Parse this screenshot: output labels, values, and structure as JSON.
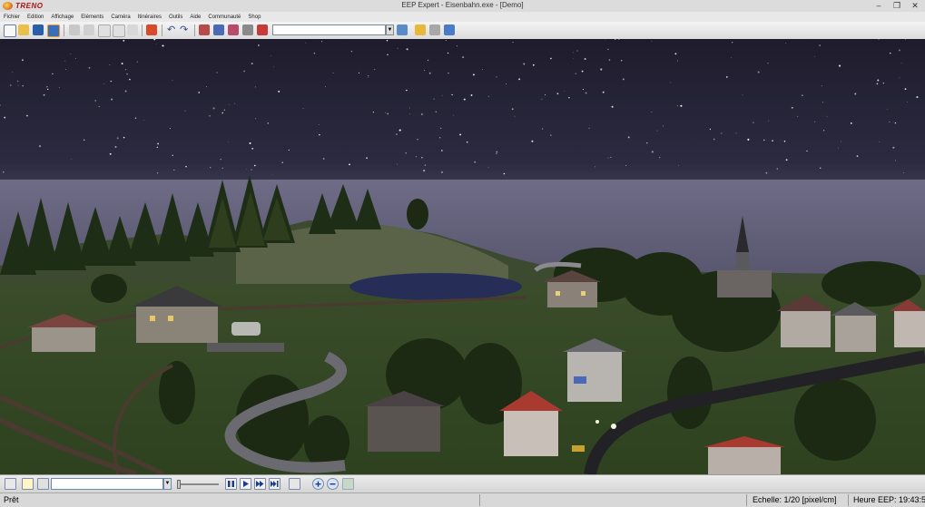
{
  "app": {
    "brand": "TRENO",
    "title": "EEP Expert - Eisenbahn.exe - [Demo]"
  },
  "menu": [
    "Fichier",
    "Edition",
    "Affichage",
    "Eléments",
    "Caméra",
    "Itinéraires",
    "Outils",
    "Aide",
    "Communauté",
    "Shop"
  ],
  "toolbar": {
    "layer_selector_value": "",
    "icons": [
      "new-file-icon",
      "open-folder-icon",
      "save-icon",
      "save-as-icon",
      "print-icon",
      "print-preview-icon",
      "window-icon",
      "window-alt-icon",
      "copy-icon",
      "paste-icon",
      "picture-icon",
      "undo-icon",
      "redo-icon",
      "train-icon-1",
      "train-icon-2",
      "train-icon-3",
      "train-icon-4",
      "train-icon-5",
      "map-icon",
      "sun-icon",
      "tools-icon",
      "book-icon"
    ]
  },
  "viewport": {
    "scene": "night-3d-railway-layout"
  },
  "controls": {
    "train_selector_value": "",
    "speed_level": 0.0,
    "buttons": [
      "pause",
      "play",
      "fast-forward",
      "skip-forward",
      "reset"
    ]
  },
  "status": {
    "ready": "Prêt",
    "scale": "Echelle:   1/20 [pixel/cm]",
    "time": "Heure EEP:  19:43:5"
  },
  "colors": {
    "sky": "#24223a",
    "horizon": "#5e5c78",
    "grass": "#3e5a2a",
    "accent": "#b01010"
  }
}
